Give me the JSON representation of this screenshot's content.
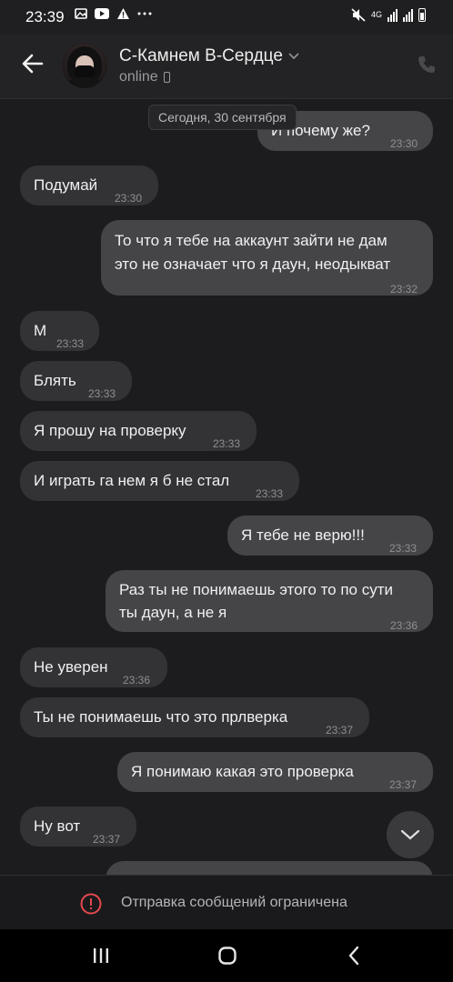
{
  "status_bar": {
    "time": "23:39",
    "network": "4G"
  },
  "header": {
    "contact_name": "С-Камнем В-Сердце",
    "status": "online"
  },
  "date_chip": "Сегодня, 30 сентября",
  "messages": [
    {
      "dir": "out",
      "text": "И почему же?",
      "time": "23:30"
    },
    {
      "dir": "in",
      "text": "Подумай",
      "time": "23:30"
    },
    {
      "dir": "out",
      "line1": "То что я тебе на аккаунт зайти не дам",
      "line2": "это не означает что я даун, неодыкват",
      "time": "23:32"
    },
    {
      "dir": "in",
      "text": "М",
      "time": "23:33"
    },
    {
      "dir": "in",
      "text": "Блять",
      "time": "23:33"
    },
    {
      "dir": "in",
      "text": "Я прошу на проверку",
      "time": "23:33"
    },
    {
      "dir": "in",
      "text": "И играть га нем я б не стал",
      "time": "23:33"
    },
    {
      "dir": "out",
      "text": "Я  тебе не верю!!!",
      "time": "23:33"
    },
    {
      "dir": "out",
      "line1": "Раз ты не понимаешь этого то по сути",
      "line2": "ты даун, а не я",
      "time": "23:36"
    },
    {
      "dir": "in",
      "text": "Не уверен",
      "time": "23:36"
    },
    {
      "dir": "in",
      "text": "Ты не понимаешь что это прлверка",
      "time": "23:37"
    },
    {
      "dir": "out",
      "text": "Я понимаю какая это проверка",
      "time": "23:37"
    },
    {
      "dir": "in",
      "text": "Ну вот",
      "time": "23:37"
    }
  ],
  "footer": {
    "restriction_text": "Отправка сообщений ограничена"
  }
}
